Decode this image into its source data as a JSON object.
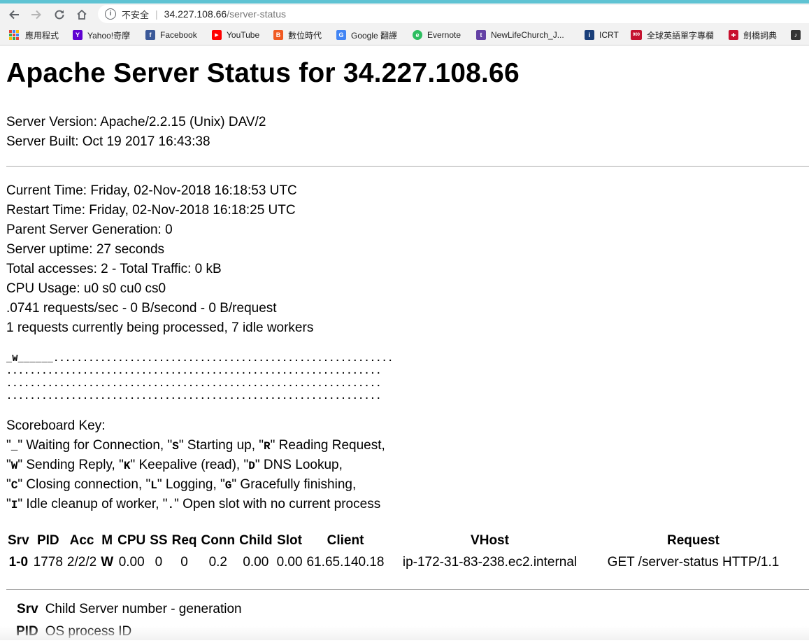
{
  "browser": {
    "security_label": "不安全",
    "url_host": "34.227.108.66",
    "url_path": "/server-status",
    "bookmarks": [
      {
        "label": "應用程式",
        "icon": "apps-grid-icon"
      },
      {
        "label": "Yahoo!奇摩",
        "icon": "yahoo-icon",
        "color": "#5f01d1",
        "glyph": "Y"
      },
      {
        "label": "Facebook",
        "icon": "facebook-icon",
        "color": "#3b5998",
        "glyph": "f"
      },
      {
        "label": "YouTube",
        "icon": "youtube-icon",
        "color": "#ff0000",
        "glyph": "▶"
      },
      {
        "label": "數位時代",
        "icon": "bn-icon",
        "color": "#f05a22",
        "glyph": "B"
      },
      {
        "label": "Google 翻譯",
        "icon": "google-translate-icon",
        "color": "#4285f4",
        "glyph": "G"
      },
      {
        "label": "Evernote",
        "icon": "evernote-icon",
        "color": "#2dbe60",
        "glyph": "e"
      },
      {
        "label": "NewLifeChurch_J...",
        "icon": "twitch-icon",
        "color": "#6441a5",
        "glyph": "t"
      },
      {
        "label": "ICRT",
        "icon": "icrt-icon",
        "color": "#1a3f7a",
        "glyph": "i"
      },
      {
        "label": "全球英語單字專欄",
        "icon": "nine-hundred-icon",
        "color": "#c4122f",
        "glyph": "900"
      },
      {
        "label": "劍橋詞典",
        "icon": "cambridge-shield-icon",
        "color": "#c8102e",
        "glyph": "✚"
      },
      {
        "label": "",
        "icon": "music-icon",
        "color": "#333333",
        "glyph": "♪"
      }
    ]
  },
  "page": {
    "title": "Apache Server Status for 34.227.108.66",
    "server_version": "Server Version: Apache/2.2.15 (Unix) DAV/2",
    "server_built": "Server Built: Oct 19 2017 16:43:38",
    "current_time": "Current Time: Friday, 02-Nov-2018 16:18:53 UTC",
    "restart_time": "Restart Time: Friday, 02-Nov-2018 16:18:25 UTC",
    "parent_generation": "Parent Server Generation: 0",
    "uptime": "Server uptime: 27 seconds",
    "accesses": "Total accesses: 2 - Total Traffic: 0 kB",
    "cpu_usage": "CPU Usage: u0 s0 cu0 cs0",
    "rates": ".0741 requests/sec - 0 B/second - 0 B/request",
    "workers": "1 requests currently being processed, 7 idle workers",
    "scoreboard": [
      "_W______..........................................................",
      "................................................................",
      "................................................................",
      "................................................................"
    ],
    "scoreboard_key_title": "Scoreboard Key:",
    "scoreboard_key_lines": [
      [
        {
          "q": "\""
        },
        {
          "k": "_"
        },
        {
          "t": "\" Waiting for Connection, \""
        },
        {
          "k": "S"
        },
        {
          "t": "\" Starting up, \""
        },
        {
          "k": "R"
        },
        {
          "t": "\" Reading Request,"
        }
      ],
      [
        {
          "q": "\""
        },
        {
          "k": "W"
        },
        {
          "t": "\" Sending Reply, \""
        },
        {
          "k": "K"
        },
        {
          "t": "\" Keepalive (read), \""
        },
        {
          "k": "D"
        },
        {
          "t": "\" DNS Lookup,"
        }
      ],
      [
        {
          "q": "\""
        },
        {
          "k": "C"
        },
        {
          "t": "\" Closing connection, \""
        },
        {
          "k": "L"
        },
        {
          "t": "\" Logging, \""
        },
        {
          "k": "G"
        },
        {
          "t": "\" Gracefully finishing,"
        }
      ],
      [
        {
          "q": "\""
        },
        {
          "k": "I"
        },
        {
          "t": "\" Idle cleanup of worker, \""
        },
        {
          "k": "."
        },
        {
          "t": "\" Open slot with no current process"
        }
      ]
    ],
    "table_headers": [
      "Srv",
      "PID",
      "Acc",
      "M",
      "CPU",
      "SS",
      "Req",
      "Conn",
      "Child",
      "Slot",
      "Client",
      "VHost",
      "Request"
    ],
    "table_rows": [
      [
        "1-0",
        "1778",
        "2/2/2",
        "W",
        "0.00",
        "0",
        "0",
        "0.2",
        "0.00",
        "0.00",
        "61.65.140.18",
        "ip-172-31-83-238.ec2.internal",
        "GET /server-status HTTP/1.1"
      ]
    ],
    "definitions": [
      {
        "term": "Srv",
        "desc": "Child Server number - generation"
      },
      {
        "term": "PID",
        "desc": "OS process ID"
      }
    ]
  }
}
